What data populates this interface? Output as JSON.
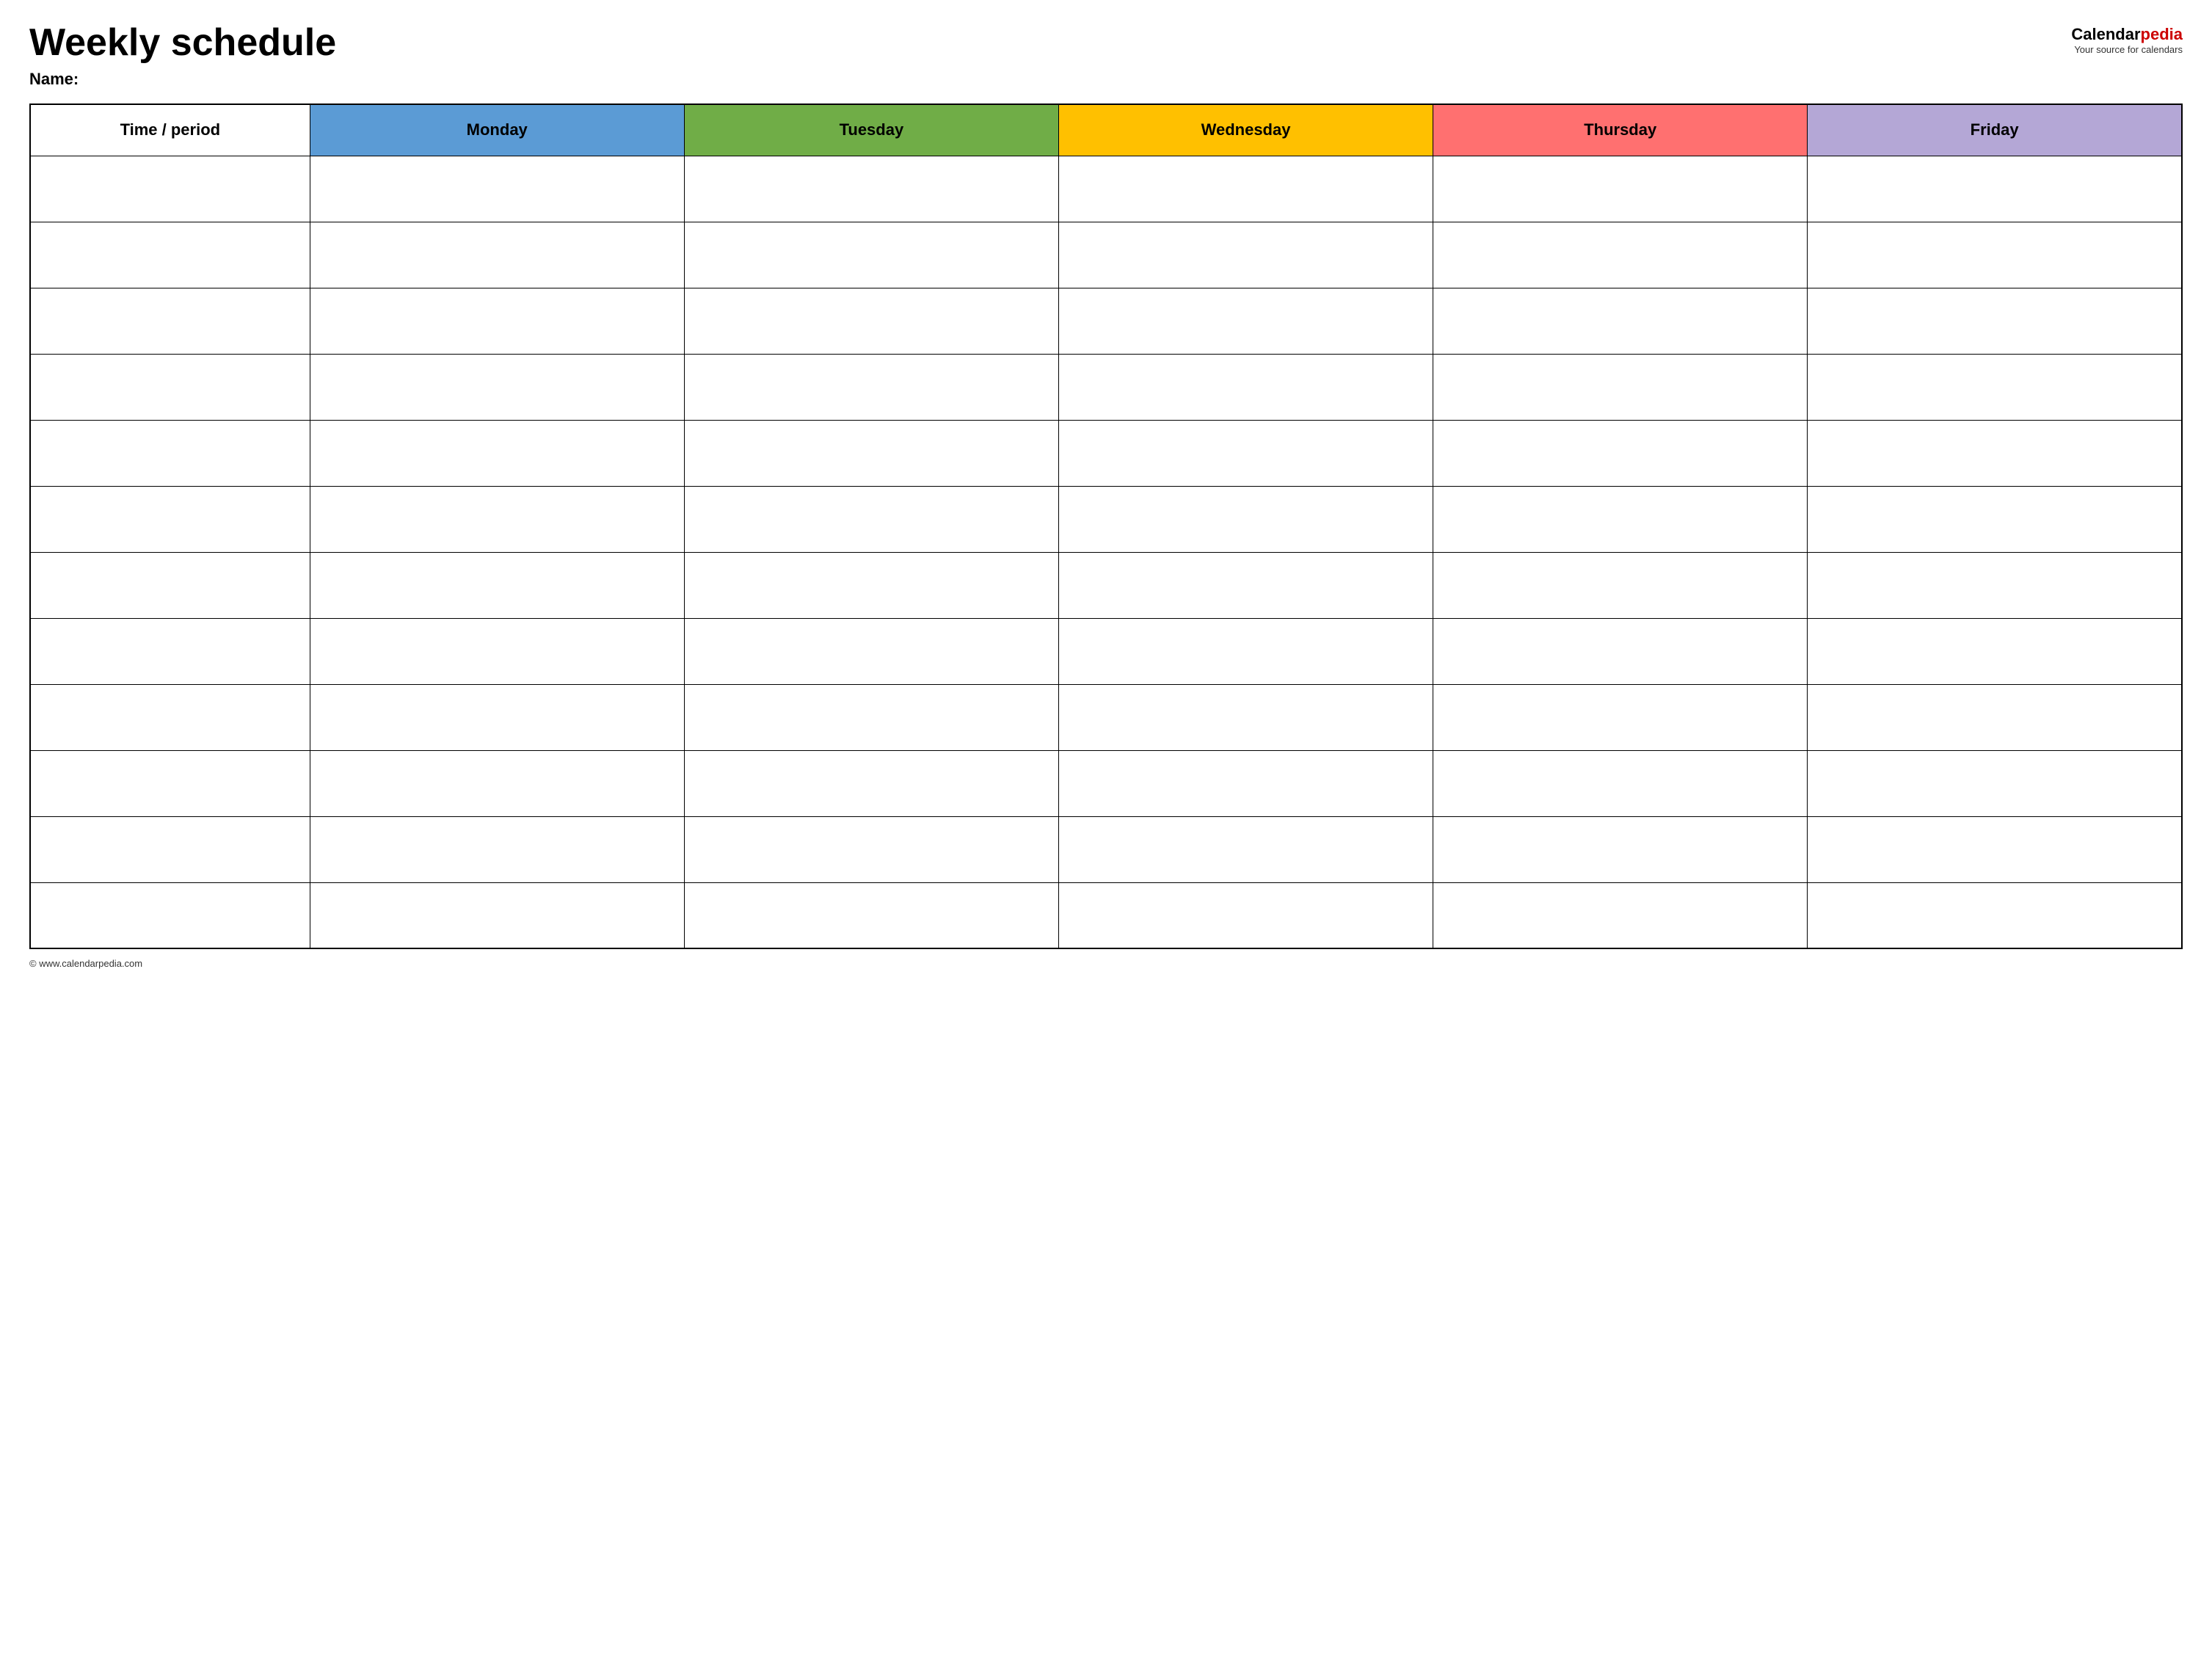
{
  "header": {
    "title": "Weekly schedule",
    "name_label": "Name:",
    "logo": {
      "calendar": "Calendar",
      "pedia": "pedia",
      "tagline": "Your source for calendars"
    }
  },
  "table": {
    "columns": [
      {
        "label": "Time / period",
        "class": "time-period-header"
      },
      {
        "label": "Monday",
        "class": "monday-header"
      },
      {
        "label": "Tuesday",
        "class": "tuesday-header"
      },
      {
        "label": "Wednesday",
        "class": "wednesday-header"
      },
      {
        "label": "Thursday",
        "class": "thursday-header"
      },
      {
        "label": "Friday",
        "class": "friday-header"
      }
    ],
    "row_count": 12
  },
  "footer": {
    "copyright": "© www.calendarpedia.com"
  }
}
